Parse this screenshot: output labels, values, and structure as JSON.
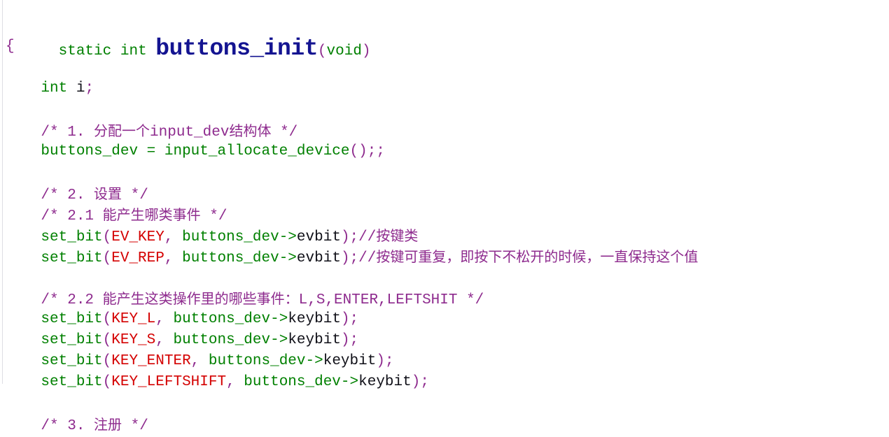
{
  "document": {
    "kind": "source-code-listing",
    "language": "C",
    "background_color": "#ffffff"
  },
  "palette": {
    "keyword_green": "#008000",
    "punctuation_purple": "#8e2b8e",
    "comment_purple": "#8e2b8e",
    "constant_red": "#d40000",
    "plain_black": "#101018",
    "title_navy": "#141491",
    "gutter_line": "#dedee4"
  },
  "signature": {
    "storage": "static",
    "return_type": "int",
    "name": "buttons_init",
    "open_paren": "(",
    "params": "void",
    "close_paren": ")"
  },
  "lines": [
    {
      "id": "line-open-brace",
      "indent": 0,
      "tokens": [
        {
          "text": "{",
          "cls": "t-punc"
        }
      ]
    },
    {
      "id": "line-blank-1",
      "blank": true
    },
    {
      "id": "line-decl-i",
      "indent": 1,
      "tokens": [
        {
          "text": "int",
          "cls": "t-kw"
        },
        {
          "text": " ",
          "cls": "t-plain"
        },
        {
          "text": "i",
          "cls": "t-plain"
        },
        {
          "text": ";",
          "cls": "t-punc"
        }
      ]
    },
    {
      "id": "line-blank-2",
      "blank": true
    },
    {
      "id": "line-comment-1",
      "indent": 1,
      "tokens": [
        {
          "text": "/* 1. ",
          "cls": "t-comment"
        },
        {
          "text": "分配一个",
          "cls": "t-comment cjk"
        },
        {
          "text": "input_dev",
          "cls": "t-comment"
        },
        {
          "text": "结构体",
          "cls": "t-comment cjk"
        },
        {
          "text": " */",
          "cls": "t-comment"
        }
      ]
    },
    {
      "id": "line-allocate-device",
      "indent": 1,
      "tokens": [
        {
          "text": "buttons_dev",
          "cls": "t-kw"
        },
        {
          "text": " = ",
          "cls": "t-kw"
        },
        {
          "text": "input_allocate_device",
          "cls": "t-kw"
        },
        {
          "text": "()",
          "cls": "t-punc"
        },
        {
          "text": ";;",
          "cls": "t-punc"
        }
      ]
    },
    {
      "id": "line-blank-3",
      "blank": true
    },
    {
      "id": "line-comment-2",
      "indent": 1,
      "tokens": [
        {
          "text": "/* 2. ",
          "cls": "t-comment"
        },
        {
          "text": "设置",
          "cls": "t-comment cjk"
        },
        {
          "text": " */",
          "cls": "t-comment"
        }
      ]
    },
    {
      "id": "line-comment-2-1",
      "indent": 1,
      "tokens": [
        {
          "text": "/* 2.1 ",
          "cls": "t-comment"
        },
        {
          "text": "能产生哪类事件",
          "cls": "t-comment cjk"
        },
        {
          "text": " */",
          "cls": "t-comment"
        }
      ]
    },
    {
      "id": "line-setbit-evkey",
      "indent": 1,
      "tokens": [
        {
          "text": "set_bit",
          "cls": "t-fn"
        },
        {
          "text": "(",
          "cls": "t-punc"
        },
        {
          "text": "EV_KEY",
          "cls": "t-const"
        },
        {
          "text": ",",
          "cls": "t-punc"
        },
        {
          "text": " buttons_dev->",
          "cls": "t-kw"
        },
        {
          "text": "evbit",
          "cls": "t-plain"
        },
        {
          "text": ")",
          "cls": "t-punc"
        },
        {
          "text": ";",
          "cls": "t-punc"
        },
        {
          "text": "//",
          "cls": "t-comment"
        },
        {
          "text": "按键类",
          "cls": "t-comment cjk"
        }
      ]
    },
    {
      "id": "line-setbit-evrep",
      "indent": 1,
      "tokens": [
        {
          "text": "set_bit",
          "cls": "t-fn"
        },
        {
          "text": "(",
          "cls": "t-punc"
        },
        {
          "text": "EV_REP",
          "cls": "t-const"
        },
        {
          "text": ",",
          "cls": "t-punc"
        },
        {
          "text": " buttons_dev->",
          "cls": "t-kw"
        },
        {
          "text": "evbit",
          "cls": "t-plain"
        },
        {
          "text": ")",
          "cls": "t-punc"
        },
        {
          "text": ";",
          "cls": "t-punc"
        },
        {
          "text": "//",
          "cls": "t-comment"
        },
        {
          "text": "按键可重复，即按下不松开的时候，一直保持这个值",
          "cls": "t-comment cjk"
        }
      ]
    },
    {
      "id": "line-blank-4",
      "blank": true
    },
    {
      "id": "line-comment-2-2",
      "indent": 1,
      "tokens": [
        {
          "text": "/* 2.2 ",
          "cls": "t-comment"
        },
        {
          "text": "能产生这类操作里的哪些事件：",
          "cls": "t-comment cjk"
        },
        {
          "text": "L,S,ENTER,LEFTSHIT */",
          "cls": "t-comment"
        }
      ]
    },
    {
      "id": "line-setbit-key-l",
      "indent": 1,
      "tokens": [
        {
          "text": "set_bit",
          "cls": "t-fn"
        },
        {
          "text": "(",
          "cls": "t-punc"
        },
        {
          "text": "KEY_L",
          "cls": "t-const"
        },
        {
          "text": ",",
          "cls": "t-punc"
        },
        {
          "text": " buttons_dev->",
          "cls": "t-kw"
        },
        {
          "text": "keybit",
          "cls": "t-plain"
        },
        {
          "text": ")",
          "cls": "t-punc"
        },
        {
          "text": ";",
          "cls": "t-punc"
        }
      ]
    },
    {
      "id": "line-setbit-key-s",
      "indent": 1,
      "tokens": [
        {
          "text": "set_bit",
          "cls": "t-fn"
        },
        {
          "text": "(",
          "cls": "t-punc"
        },
        {
          "text": "KEY_S",
          "cls": "t-const"
        },
        {
          "text": ",",
          "cls": "t-punc"
        },
        {
          "text": " buttons_dev->",
          "cls": "t-kw"
        },
        {
          "text": "keybit",
          "cls": "t-plain"
        },
        {
          "text": ")",
          "cls": "t-punc"
        },
        {
          "text": ";",
          "cls": "t-punc"
        }
      ]
    },
    {
      "id": "line-setbit-key-enter",
      "indent": 1,
      "tokens": [
        {
          "text": "set_bit",
          "cls": "t-fn"
        },
        {
          "text": "(",
          "cls": "t-punc"
        },
        {
          "text": "KEY_ENTER",
          "cls": "t-const"
        },
        {
          "text": ",",
          "cls": "t-punc"
        },
        {
          "text": " buttons_dev->",
          "cls": "t-kw"
        },
        {
          "text": "keybit",
          "cls": "t-plain"
        },
        {
          "text": ")",
          "cls": "t-punc"
        },
        {
          "text": ";",
          "cls": "t-punc"
        }
      ]
    },
    {
      "id": "line-setbit-key-leftshift",
      "indent": 1,
      "tokens": [
        {
          "text": "set_bit",
          "cls": "t-fn"
        },
        {
          "text": "(",
          "cls": "t-punc"
        },
        {
          "text": "KEY_LEFTSHIFT",
          "cls": "t-const"
        },
        {
          "text": ",",
          "cls": "t-punc"
        },
        {
          "text": " buttons_dev->",
          "cls": "t-kw"
        },
        {
          "text": "keybit",
          "cls": "t-plain"
        },
        {
          "text": ")",
          "cls": "t-punc"
        },
        {
          "text": ";",
          "cls": "t-punc"
        }
      ]
    },
    {
      "id": "line-blank-5",
      "blank": true
    },
    {
      "id": "line-comment-3",
      "indent": 1,
      "tokens": [
        {
          "text": "/* 3. ",
          "cls": "t-comment"
        },
        {
          "text": "注册",
          "cls": "t-comment cjk"
        },
        {
          "text": " */",
          "cls": "t-comment"
        }
      ]
    }
  ]
}
